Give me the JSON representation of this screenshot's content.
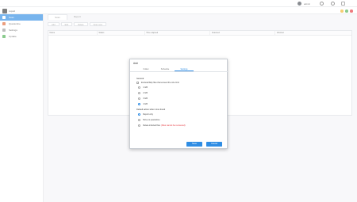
{
  "topbar": {
    "user": "admin"
  },
  "app": {
    "title": "Liquid"
  },
  "sidebar": {
    "items": [
      {
        "label": "Scan",
        "color": "#2f8de4"
      },
      {
        "label": "Quarantine",
        "color": "#e06b3a"
      },
      {
        "label": "Settings",
        "color": "#9a9a9a"
      },
      {
        "label": "Update",
        "color": "#4caf50"
      }
    ]
  },
  "main": {
    "tabs": [
      {
        "label": "Scan"
      },
      {
        "label": "Report"
      }
    ],
    "toolbar": [
      {
        "label": "Add"
      },
      {
        "label": "Edit"
      },
      {
        "label": "Delete"
      },
      {
        "label": "Scan now"
      }
    ],
    "columns": [
      "Name",
      "Status",
      "Time elapsed",
      "Scanned",
      "Infected"
    ]
  },
  "dialog": {
    "title": "Add",
    "tabs": [
      {
        "label": "Folder"
      },
      {
        "label": "Schedule"
      },
      {
        "label": "Settings"
      }
    ],
    "general_label": "General",
    "skip_label": "Exclude/Skip files that exceed the size limit",
    "sizes": [
      "1 GB",
      "2 GB",
      "3 GB",
      "4 GB"
    ],
    "selected_size_index": 3,
    "action_label": "Default action when virus found",
    "actions": [
      "Report only",
      "Move to quarantine",
      "Delete infected files"
    ],
    "delete_warning": "(Files cannot be recovered)",
    "selected_action_index": 0,
    "ok_label": "Save",
    "cancel_label": "Cancel"
  }
}
